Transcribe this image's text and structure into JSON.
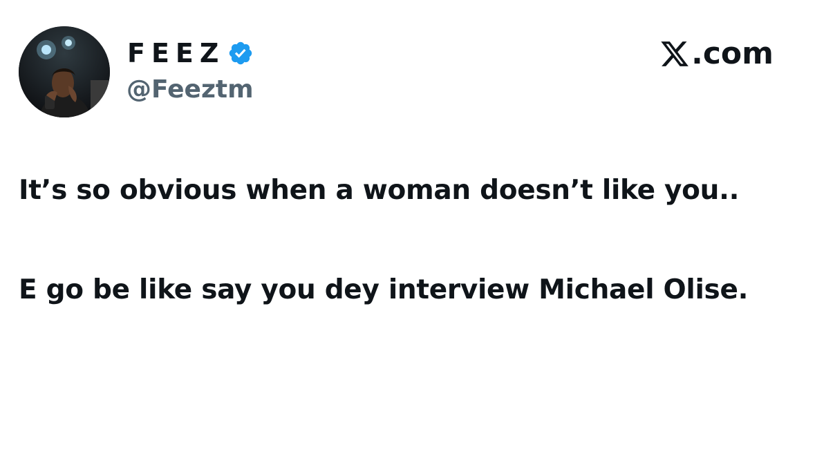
{
  "author": {
    "display_name": "FEEZ",
    "handle": "@Feeztm",
    "verified": true,
    "avatar_icon": "profile-photo",
    "badge_color": "#1d9bf0"
  },
  "brand": {
    "logo_icon": "x-logo-icon",
    "text": ".com"
  },
  "tweet": {
    "paragraphs": [
      "It’s so obvious when a woman doesn’t like you..",
      "E go be like say you dey interview Michael Olise."
    ]
  },
  "colors": {
    "text": "#0f1419",
    "secondary_text": "#536471",
    "background": "#ffffff",
    "accent": "#1d9bf0"
  }
}
